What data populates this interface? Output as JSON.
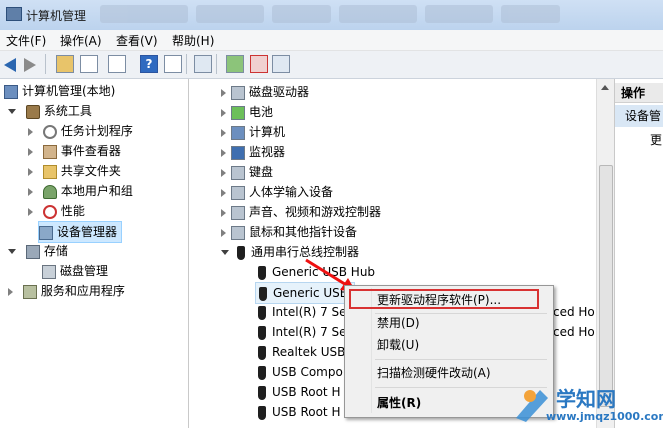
{
  "window": {
    "title": "计算机管理"
  },
  "menu": [
    "文件(F)",
    "操作(A)",
    "查看(V)",
    "帮助(H)"
  ],
  "left_tree": {
    "root": "计算机管理(本地)",
    "system_tools": "系统工具",
    "children": [
      "任务计划程序",
      "事件查看器",
      "共享文件夹",
      "本地用户和组",
      "性能",
      "设备管理器"
    ],
    "storage": "存储",
    "disk": "磁盘管理",
    "services": "服务和应用程序"
  },
  "device_tree": {
    "categories": [
      "磁盘驱动器",
      "电池",
      "计算机",
      "监视器",
      "键盘",
      "人体学输入设备",
      "声音、视频和游戏控制器",
      "鼠标和其他指针设备",
      "通用串行总线控制器"
    ],
    "usb_items": [
      "Generic USB Hub",
      "Generic USB",
      "Intel(R) 7 Se",
      "Intel(R) 7 Se",
      "Realtek USB",
      "USB Compo",
      "USB Root H",
      "USB Root H"
    ],
    "overflow_right": [
      "ced Ho",
      "ced Ho"
    ]
  },
  "actions": {
    "header": "操作",
    "selected": "设备管",
    "more": "更"
  },
  "context_menu": {
    "items": [
      "更新驱动程序软件(P)...",
      "禁用(D)",
      "卸载(U)",
      "扫描检测硬件改动(A)",
      "属性(R)"
    ]
  },
  "watermark": {
    "name": "学知网",
    "url": "www.jmqz1000.com"
  }
}
